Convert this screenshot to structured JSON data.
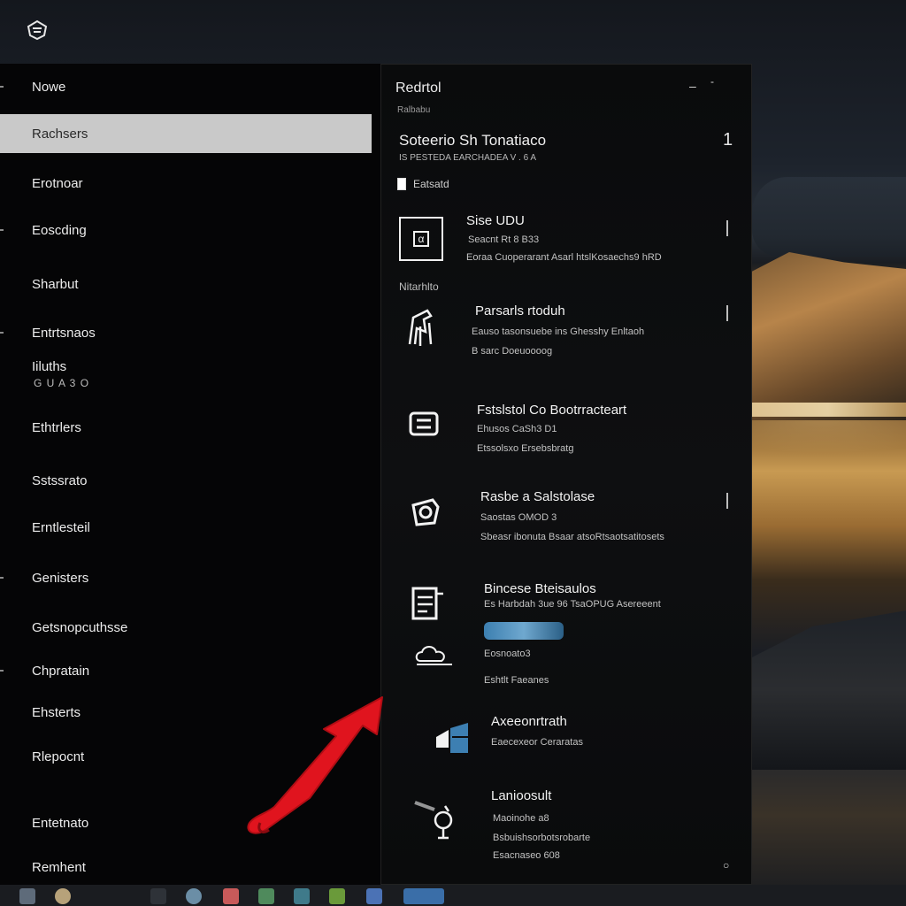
{
  "panel": {
    "title": "Redrtol",
    "subtitle": "Ralbabu",
    "section_title": "Soteerio Sh Tonatiaco",
    "section_desc": "IS PESTEDA EARCHADEA V . 6 A",
    "section_number": "1",
    "checkbox_label": "Eatsatd",
    "group_label": "Nitarhlto",
    "corner_glyph": "○",
    "minimize_glyph": "–",
    "dash_glyph": "-"
  },
  "nav": {
    "items": [
      {
        "label": "Nowe"
      },
      {
        "label": "Rachsers"
      },
      {
        "label": "Erotnoar"
      },
      {
        "label": "Eoscding"
      },
      {
        "label": "Sharbut"
      },
      {
        "label": "Entrtsnaos"
      },
      {
        "label": "Iiluths",
        "sub": "G U A 3 O"
      },
      {
        "label": "Ethtrlers"
      },
      {
        "label": "Sstssrato"
      },
      {
        "label": "Erntlesteil"
      },
      {
        "label": "Genisters"
      },
      {
        "label": "Getsnopcuthsse"
      },
      {
        "label": "Chpratain"
      },
      {
        "label": "Ehsterts"
      },
      {
        "label": "Rlepocnt"
      },
      {
        "label": "Entetnato"
      },
      {
        "label": "Remhent"
      }
    ]
  },
  "settings": [
    {
      "title": "Sise UDU",
      "lines": [
        "Seacnt Rt 8 B33",
        "Eoraa Cuoperarant Asarl htslKosaechs9 hRD"
      ],
      "icon": "window-box-icon"
    },
    {
      "title": "Parsarls rtoduh",
      "lines": [
        "Eauso tasonsuebe ins Ghesshy Enltaoh",
        "B sarc Doeuoooog"
      ],
      "icon": "accessibility-person-icon"
    },
    {
      "title": "Fstslstol Co Bootrracteart",
      "lines": [
        "Ehusos CaSh3 D1",
        "Etssolsxo Ersebsbratg"
      ],
      "icon": "keyboard-tray-icon"
    },
    {
      "title": "Rasbe a Salstolase",
      "lines": [
        "Saostas OMOD 3",
        "Sbeasr ibonuta Bsaar atsoRtsaotsatitosets"
      ],
      "icon": "sync-privacy-icon"
    },
    {
      "title": "Bincese Bteisaulos",
      "lines": [
        "Es Harbdah 3ue 96 TsaOPUG Asereeent",
        "Eosnoato3",
        "Eshtlt Faeanes"
      ],
      "icon": "update-cloud-icon"
    },
    {
      "title": "Axeeonrtrath",
      "lines": [
        "Eaecexeor Ceraratas"
      ],
      "icon": "windows-logo-icon"
    },
    {
      "title": "Lanioosult",
      "lines": [
        "Maoinohe a8",
        "Bsbuishsorbotsrobarte",
        "Esacnaseo 608"
      ],
      "icon": "sound-speaker-icon"
    }
  ],
  "colors": {
    "selected_bg": "#c9c9c9",
    "accent_red": "#e0141e",
    "accent_blue": "#3d7fb2"
  }
}
